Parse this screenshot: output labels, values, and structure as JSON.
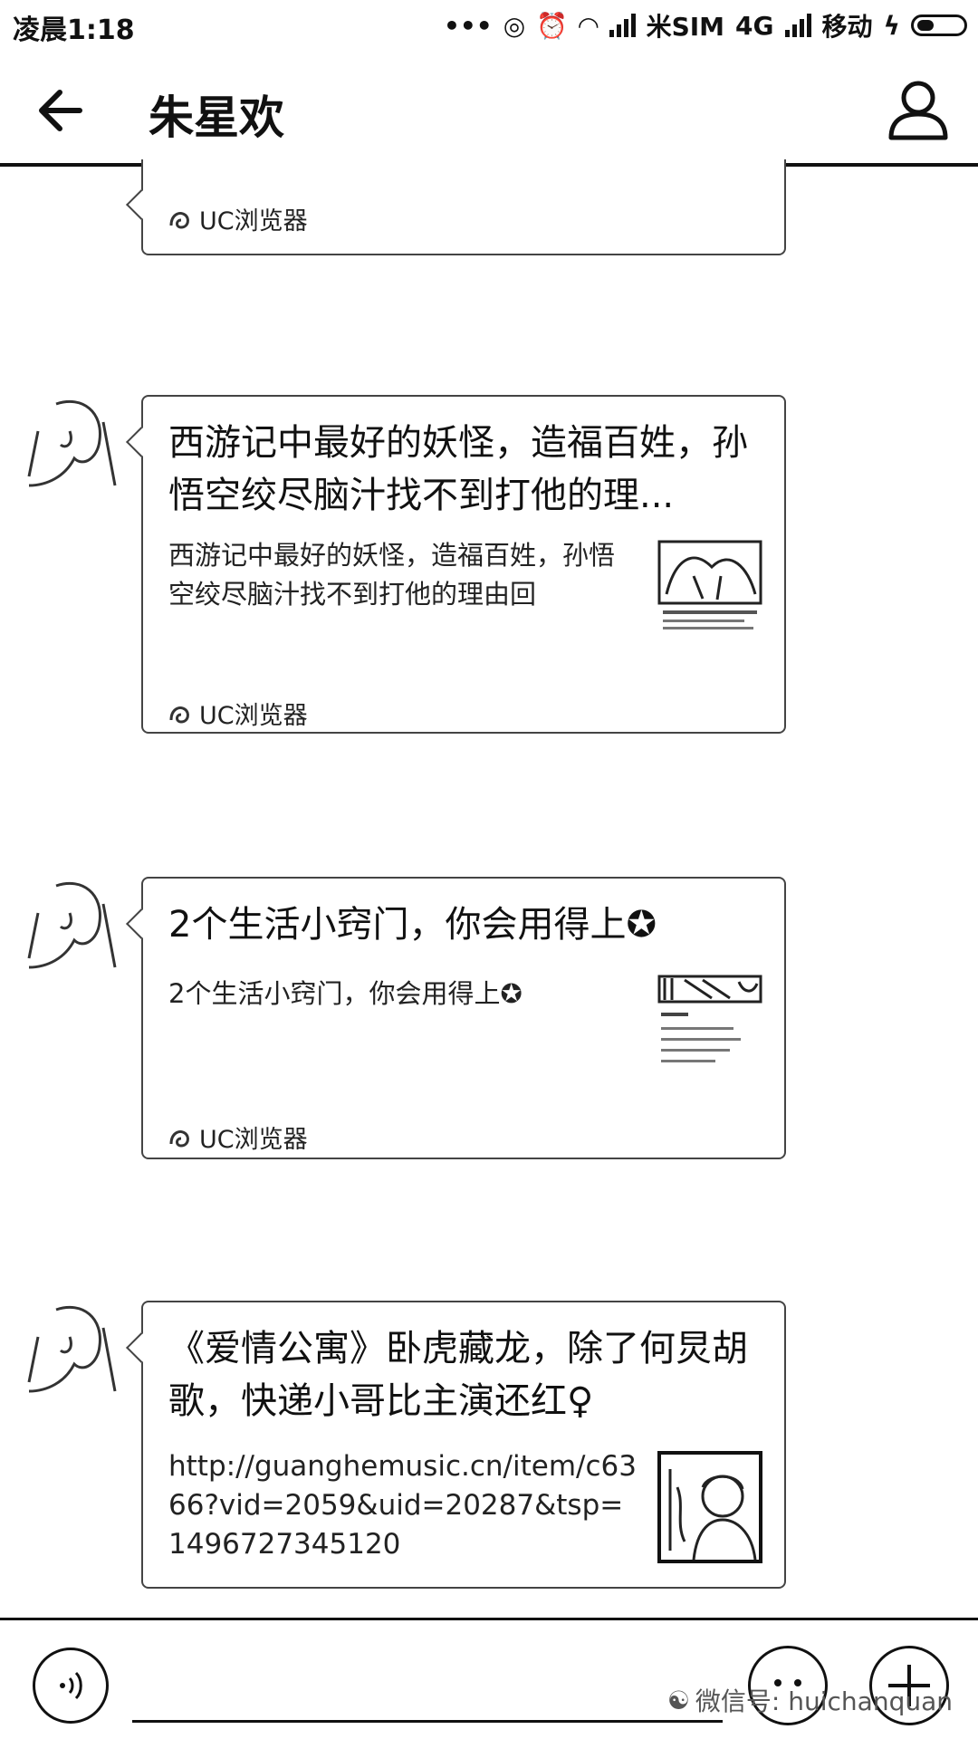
{
  "status_bar": {
    "time": "凌晨1:18",
    "sim1": "米SIM",
    "network": "4G",
    "carrier": "移动"
  },
  "header": {
    "title": "朱星欢"
  },
  "messages": [
    {
      "source": "UC浏览器"
    },
    {
      "title": "西游记中最好的妖怪，造福百姓，孙悟空绞尽脑汁找不到打他的理...",
      "desc": "西游记中最好的妖怪，造福百姓，孙悟空绞尽脑汁找不到打他的理由回",
      "source": "UC浏览器"
    },
    {
      "title": "2个生活小窍门，你会用得上✪",
      "desc": "2个生活小窍门，你会用得上✪",
      "source": "UC浏览器"
    },
    {
      "title": "《爱情公寓》卧虎藏龙，除了何炅胡歌，快递小哥比主演还红♀",
      "desc": "http://guanghemusic.cn/item/c6366?vid=2059&uid=20287&tsp=1496727345120"
    }
  ],
  "bottom_bar": {
    "watermark": "微信号: huichanquan"
  }
}
